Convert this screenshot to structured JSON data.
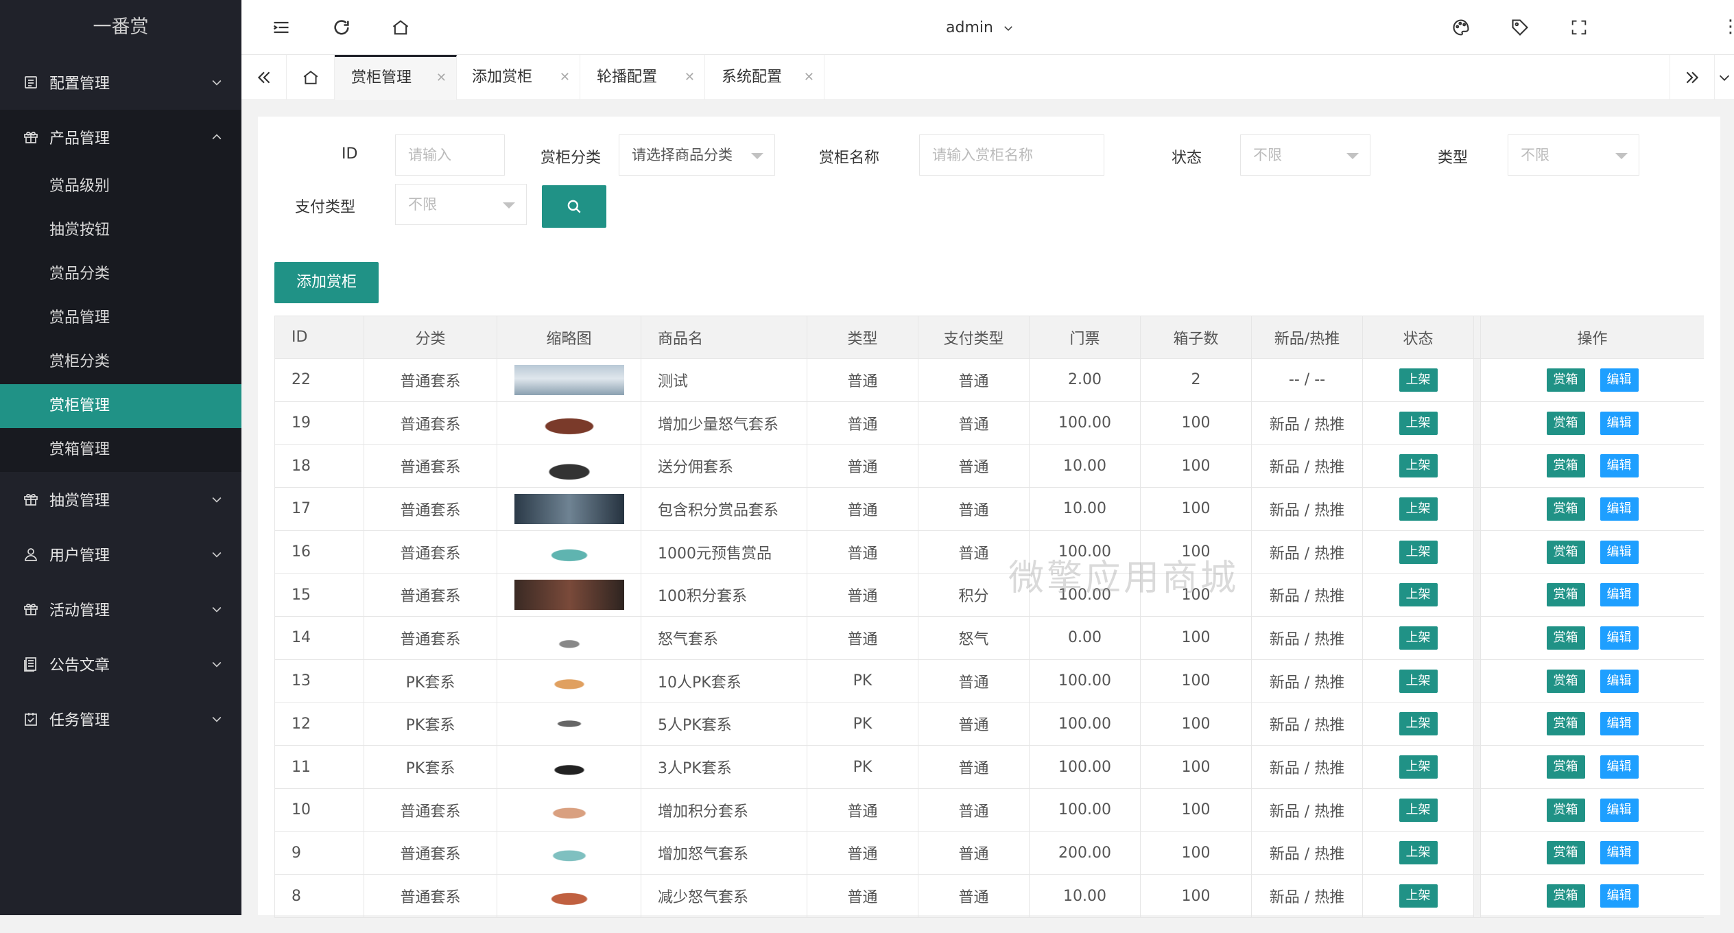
{
  "app": {
    "logo": "一番赏"
  },
  "sidebar": {
    "items": [
      {
        "label": "配置管理",
        "icon": "config-icon",
        "open": false
      },
      {
        "label": "产品管理",
        "icon": "gift-icon",
        "open": true,
        "children": [
          "赏品级别",
          "抽赏按钮",
          "赏品分类",
          "赏品管理",
          "赏柜分类",
          "赏柜管理",
          "赏箱管理"
        ],
        "active_child": "赏柜管理"
      },
      {
        "label": "抽赏管理",
        "icon": "gift-icon",
        "open": false
      },
      {
        "label": "用户管理",
        "icon": "user-icon",
        "open": false
      },
      {
        "label": "活动管理",
        "icon": "gift-icon",
        "open": false
      },
      {
        "label": "公告文章",
        "icon": "article-icon",
        "open": false
      },
      {
        "label": "任务管理",
        "icon": "task-icon",
        "open": false
      }
    ]
  },
  "topbar": {
    "user": "admin"
  },
  "tabs": [
    {
      "label": "赏柜管理",
      "active": true
    },
    {
      "label": "添加赏柜",
      "active": false
    },
    {
      "label": "轮播配置",
      "active": false
    },
    {
      "label": "系统配置",
      "active": false
    }
  ],
  "filters": {
    "id": {
      "label": "ID",
      "placeholder": "请输入"
    },
    "category": {
      "label": "赏柜分类",
      "value": "请选择商品分类"
    },
    "name": {
      "label": "赏柜名称",
      "placeholder": "请输入赏柜名称"
    },
    "status": {
      "label": "状态",
      "value": "不限"
    },
    "type": {
      "label": "类型",
      "value": "不限"
    },
    "pay_type": {
      "label": "支付类型",
      "value": "不限"
    }
  },
  "actions": {
    "add_label": "添加赏柜"
  },
  "table": {
    "headers": [
      "ID",
      "分类",
      "缩略图",
      "商品名",
      "类型",
      "支付类型",
      "门票",
      "箱子数",
      "新品/热推",
      "状态",
      "操作"
    ],
    "rows": [
      {
        "id": "22",
        "category": "普通套系",
        "name": "测试",
        "type": "普通",
        "pay": "普通",
        "ticket": "2.00",
        "boxes": "2",
        "flags": "-- / --",
        "status": "上架"
      },
      {
        "id": "19",
        "category": "普通套系",
        "name": "增加少量怒气套系",
        "type": "普通",
        "pay": "普通",
        "ticket": "100.00",
        "boxes": "100",
        "flags": "新品 / 热推",
        "status": "上架"
      },
      {
        "id": "18",
        "category": "普通套系",
        "name": "送分佣套系",
        "type": "普通",
        "pay": "普通",
        "ticket": "10.00",
        "boxes": "100",
        "flags": "新品 / 热推",
        "status": "上架"
      },
      {
        "id": "17",
        "category": "普通套系",
        "name": "包含积分赏品套系",
        "type": "普通",
        "pay": "普通",
        "ticket": "10.00",
        "boxes": "100",
        "flags": "新品 / 热推",
        "status": "上架"
      },
      {
        "id": "16",
        "category": "普通套系",
        "name": "1000元预售赏品",
        "type": "普通",
        "pay": "普通",
        "ticket": "100.00",
        "boxes": "100",
        "flags": "新品 / 热推",
        "status": "上架"
      },
      {
        "id": "15",
        "category": "普通套系",
        "name": "100积分套系",
        "type": "普通",
        "pay": "积分",
        "ticket": "100.00",
        "boxes": "100",
        "flags": "新品 / 热推",
        "status": "上架"
      },
      {
        "id": "14",
        "category": "普通套系",
        "name": "怒气套系",
        "type": "普通",
        "pay": "怒气",
        "ticket": "0.00",
        "boxes": "100",
        "flags": "新品 / 热推",
        "status": "上架"
      },
      {
        "id": "13",
        "category": "PK套系",
        "name": "10人PK套系",
        "type": "PK",
        "pay": "普通",
        "ticket": "100.00",
        "boxes": "100",
        "flags": "新品 / 热推",
        "status": "上架"
      },
      {
        "id": "12",
        "category": "PK套系",
        "name": "5人PK套系",
        "type": "PK",
        "pay": "普通",
        "ticket": "100.00",
        "boxes": "100",
        "flags": "新品 / 热推",
        "status": "上架"
      },
      {
        "id": "11",
        "category": "PK套系",
        "name": "3人PK套系",
        "type": "PK",
        "pay": "普通",
        "ticket": "100.00",
        "boxes": "100",
        "flags": "新品 / 热推",
        "status": "上架"
      },
      {
        "id": "10",
        "category": "普通套系",
        "name": "增加积分套系",
        "type": "普通",
        "pay": "普通",
        "ticket": "100.00",
        "boxes": "100",
        "flags": "新品 / 热推",
        "status": "上架"
      },
      {
        "id": "9",
        "category": "普通套系",
        "name": "增加怒气套系",
        "type": "普通",
        "pay": "普通",
        "ticket": "200.00",
        "boxes": "100",
        "flags": "新品 / 热推",
        "status": "上架"
      },
      {
        "id": "8",
        "category": "普通套系",
        "name": "减少怒气套系",
        "type": "普通",
        "pay": "普通",
        "ticket": "10.00",
        "boxes": "100",
        "flags": "新品 / 热推",
        "status": "上架"
      }
    ],
    "row_actions": {
      "box_label": "赏箱",
      "edit_label": "编辑"
    }
  },
  "watermark": "微擎应用商城",
  "colors": {
    "accent": "#209286",
    "sidebar_bg": "#20222a",
    "edit_blue": "#1e9fff"
  }
}
